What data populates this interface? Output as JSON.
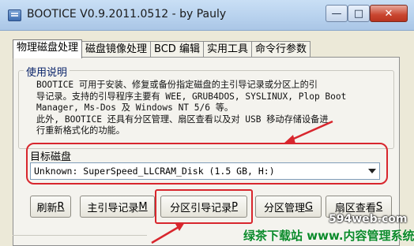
{
  "window": {
    "title": "BOOTICE V0.9.2011.0512 - by Pauly",
    "icon": "app-window-icon",
    "controls": {
      "minimize": "—",
      "maximize": "□",
      "close": "✕"
    }
  },
  "tabs": [
    {
      "label": "物理磁盘处理",
      "active": true
    },
    {
      "label": "磁盘镜像处理",
      "active": false
    },
    {
      "label": "BCD 编辑",
      "active": false
    },
    {
      "label": "实用工具",
      "active": false
    },
    {
      "label": "命令行参数",
      "active": false
    }
  ],
  "usage": {
    "legend": "使用说明",
    "text": "BOOTICE 可用于安装、修复或备份指定磁盘的主引导记录或分区上的引\n导记录。支持的引导程序主要有 WEE, GRUB4DOS, SYSLINUX, Plop Boot\nManager, Ms-Dos 及 Windows NT 5/6 等。\n此外, BOOTICE 还具有分区管理、扇区查看以及对 USB 移动存储设备进\n行重新格式化的功能。"
  },
  "target": {
    "label": "目标磁盘",
    "selected": "Unknown: SuperSpeed_LLCRAM_Disk (1.5 GB, H:)"
  },
  "buttons": [
    {
      "label": "刷新",
      "hotkey": "R"
    },
    {
      "label": "主引导记录",
      "hotkey": "M"
    },
    {
      "label": "分区引导记录",
      "hotkey": "P"
    },
    {
      "label": "分区管理",
      "hotkey": "G"
    },
    {
      "label": "扇区查看",
      "hotkey": "S"
    }
  ],
  "watermark": {
    "site": "594web.com",
    "name": "绿茶下载站 www.内容管理系统"
  },
  "colors": {
    "highlight": "#d8262d",
    "titlebar": "#b8d2ee"
  }
}
